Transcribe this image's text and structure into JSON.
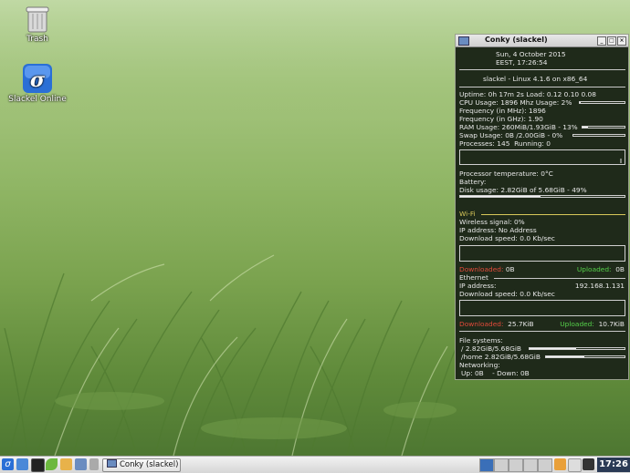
{
  "desktop": {
    "icons": [
      {
        "label": "Trash",
        "icon": "trash-icon"
      },
      {
        "label": "Slackel Online",
        "icon": "slackel-logo-icon"
      }
    ]
  },
  "conky": {
    "title": "Conky (slackel)",
    "date_line": "Sun,  4 October 2015",
    "time_line": "EEST,  17:26:54",
    "system": "slackel - Linux 4.1.6 on x86_64",
    "uptime_label": "Uptime:",
    "uptime_value": "0h 17m 2s",
    "load_label": "Load:",
    "load_value": "0.12 0.10 0.08",
    "cpu_label": "CPU Usage:",
    "cpu_freq": "1896 Mhz",
    "cpu_usage_label": "Usage:",
    "cpu_usage_value": "2%",
    "freq_mhz_label": "Frequency (in MHz):",
    "freq_mhz_value": "1896",
    "freq_ghz_label": "Frequency (in GHz):",
    "freq_ghz_value": "1.90",
    "ram_label": "RAM Usage:",
    "ram_value": "260MiB/1.93GiB - 13%",
    "ram_fraction": 0.13,
    "swap_label": "Swap Usage:",
    "swap_value": "0B  /2.00GiB - 0%",
    "swap_fraction": 0.0,
    "processes_label": "Processes:",
    "processes_value": "145",
    "running_label": "Running:",
    "running_value": "0",
    "temp_label": "Processor temperature:",
    "temp_value": "0°C",
    "battery_label": "Battery:",
    "disk_label": "Disk usage:",
    "disk_value": "2.82GiB of 5.68GiB - 49%",
    "disk_fraction": 0.49,
    "wifi_header": "Wi-Fi",
    "wireless_label": "Wireless signal:",
    "wireless_value": "0%",
    "wifi_ip_label": "IP address:",
    "wifi_ip_value": "No Address",
    "wifi_dl_label": "Download speed:",
    "wifi_dl_value": "0.0 Kb/sec",
    "wifi_downloaded_label": "Downloaded:",
    "wifi_downloaded_value": "0B",
    "wifi_uploaded_label": "Uploaded:",
    "wifi_uploaded_value": "0B",
    "eth_header": "Ethernet",
    "eth_ip_label": "IP address:",
    "eth_ip_value": "192.168.1.131",
    "eth_dl_label": "Download speed:",
    "eth_dl_value": "0.0 Kb/sec",
    "eth_downloaded_label": "Downloaded:",
    "eth_downloaded_value": "25.7KiB",
    "eth_uploaded_label": "Uploaded:",
    "eth_uploaded_value": "10.7KiB",
    "fs_label": "File systems:",
    "fs_root": "/ 2.82GiB/5.68GiB",
    "fs_root_fraction": 0.49,
    "fs_home": "/home 2.82GiB/5.68GiB",
    "fs_home_fraction": 0.49,
    "net_label": "Networking:",
    "net_up_label": "Up:",
    "net_up_value": "0B",
    "net_down_label": "- Down:",
    "net_down_value": "0B"
  },
  "taskbar": {
    "task_label": "Conky (slackel)",
    "clock": "17:26"
  },
  "colors": {
    "downloaded": "#e24a3a",
    "uploaded": "#55d14a",
    "section": "#d8c85a"
  }
}
